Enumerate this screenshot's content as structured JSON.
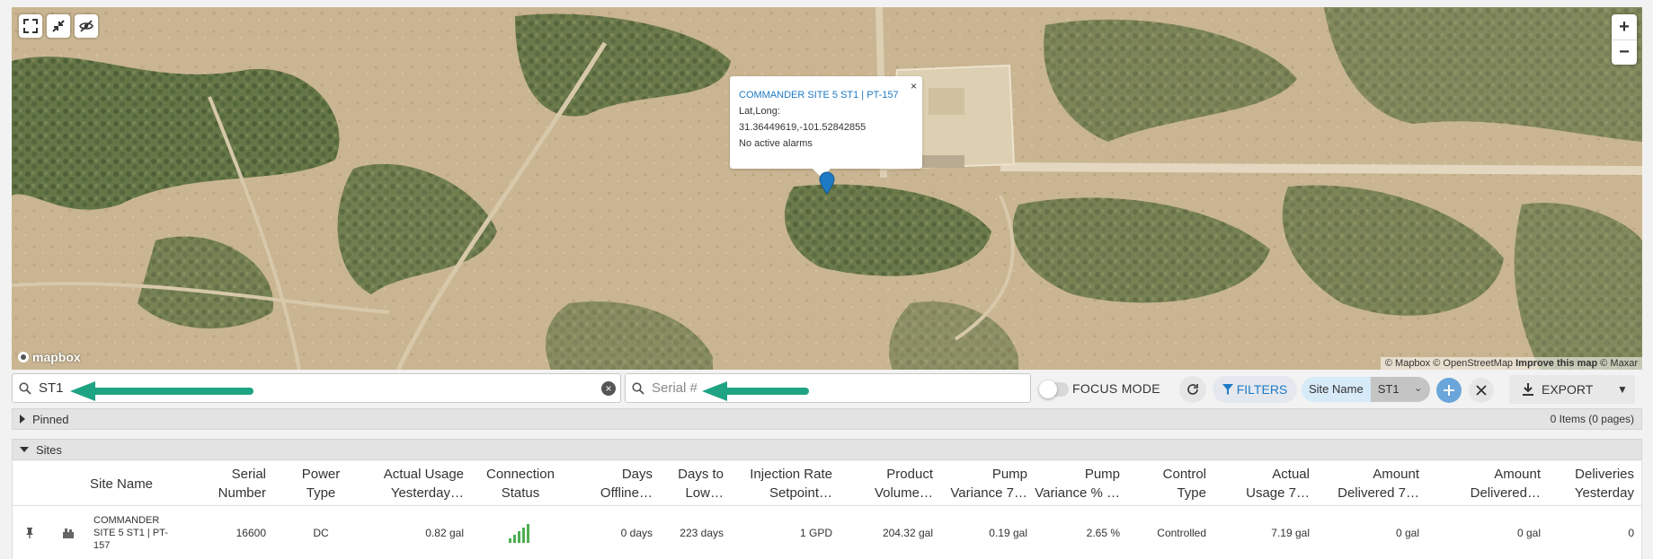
{
  "map": {
    "controls": {
      "expand_icon": "expand-icon",
      "shrink_icon": "shrink-icon",
      "hide_icon": "eye-off-icon",
      "zoom_in": "+",
      "zoom_out": "−"
    },
    "popup": {
      "title": "COMMANDER SITE 5 ST1 | PT-157",
      "close": "×",
      "latlong_label": "Lat,Long:",
      "coords": "31.36449619,-101.52842855",
      "alarm_text": "No active alarms"
    },
    "logo_text": "mapbox",
    "attribution": {
      "mapbox": "© Mapbox",
      "osm": "© OpenStreetMap",
      "improve": "Improve this map",
      "maxar": "© Maxar"
    },
    "colors": {
      "pin": "#1f7ac4",
      "ground": "#c8b48e",
      "vegetation": "#3f5a2e"
    }
  },
  "toolbar": {
    "site_search_value": "ST1",
    "serial_placeholder": "Serial #",
    "focus_mode_label": "FOCUS MODE",
    "filters_label": "FILTERS",
    "chip_key": "Site Name",
    "chip_value": "ST1",
    "export_label": "EXPORT",
    "arrow_color": "#1ea383"
  },
  "pinned": {
    "label": "Pinned",
    "summary": "0 Items (0 pages)"
  },
  "sites": {
    "label": "Sites",
    "columns": [
      [
        "",
        "Site Name"
      ],
      [
        "Serial",
        "Number"
      ],
      [
        "Power",
        "Type"
      ],
      [
        "Actual Usage",
        "Yesterday…"
      ],
      [
        "Connection",
        "Status"
      ],
      [
        "Days",
        "Offline…"
      ],
      [
        "Days to",
        "Low…"
      ],
      [
        "Injection Rate",
        "Setpoint…"
      ],
      [
        "Product",
        "Volume…"
      ],
      [
        "Pump",
        "Variance 7…"
      ],
      [
        "Pump",
        "Variance % …"
      ],
      [
        "Control",
        "Type"
      ],
      [
        "Actual",
        "Usage 7…"
      ],
      [
        "Amount",
        "Delivered 7…"
      ],
      [
        "Amount",
        "Delivered…"
      ],
      [
        "Deliveries",
        "Yesterday"
      ]
    ],
    "rows": [
      {
        "site_name": "COMMANDER SITE 5 ST1 | PT-157",
        "serial": "16600",
        "power": "DC",
        "usage_yesterday": "0.82 gal",
        "connection_bars": 5,
        "days_offline": "0 days",
        "days_to_low": "223 days",
        "injection_rate": "1 GPD",
        "product_volume": "204.32 gal",
        "pump_variance": "0.19 gal",
        "pump_variance_pct": "2.65 %",
        "control_type": "Controlled",
        "actual_usage_7": "7.19 gal",
        "amount_delivered_7": "0 gal",
        "amount_delivered": "0 gal",
        "deliveries_yesterday": "0"
      }
    ]
  }
}
